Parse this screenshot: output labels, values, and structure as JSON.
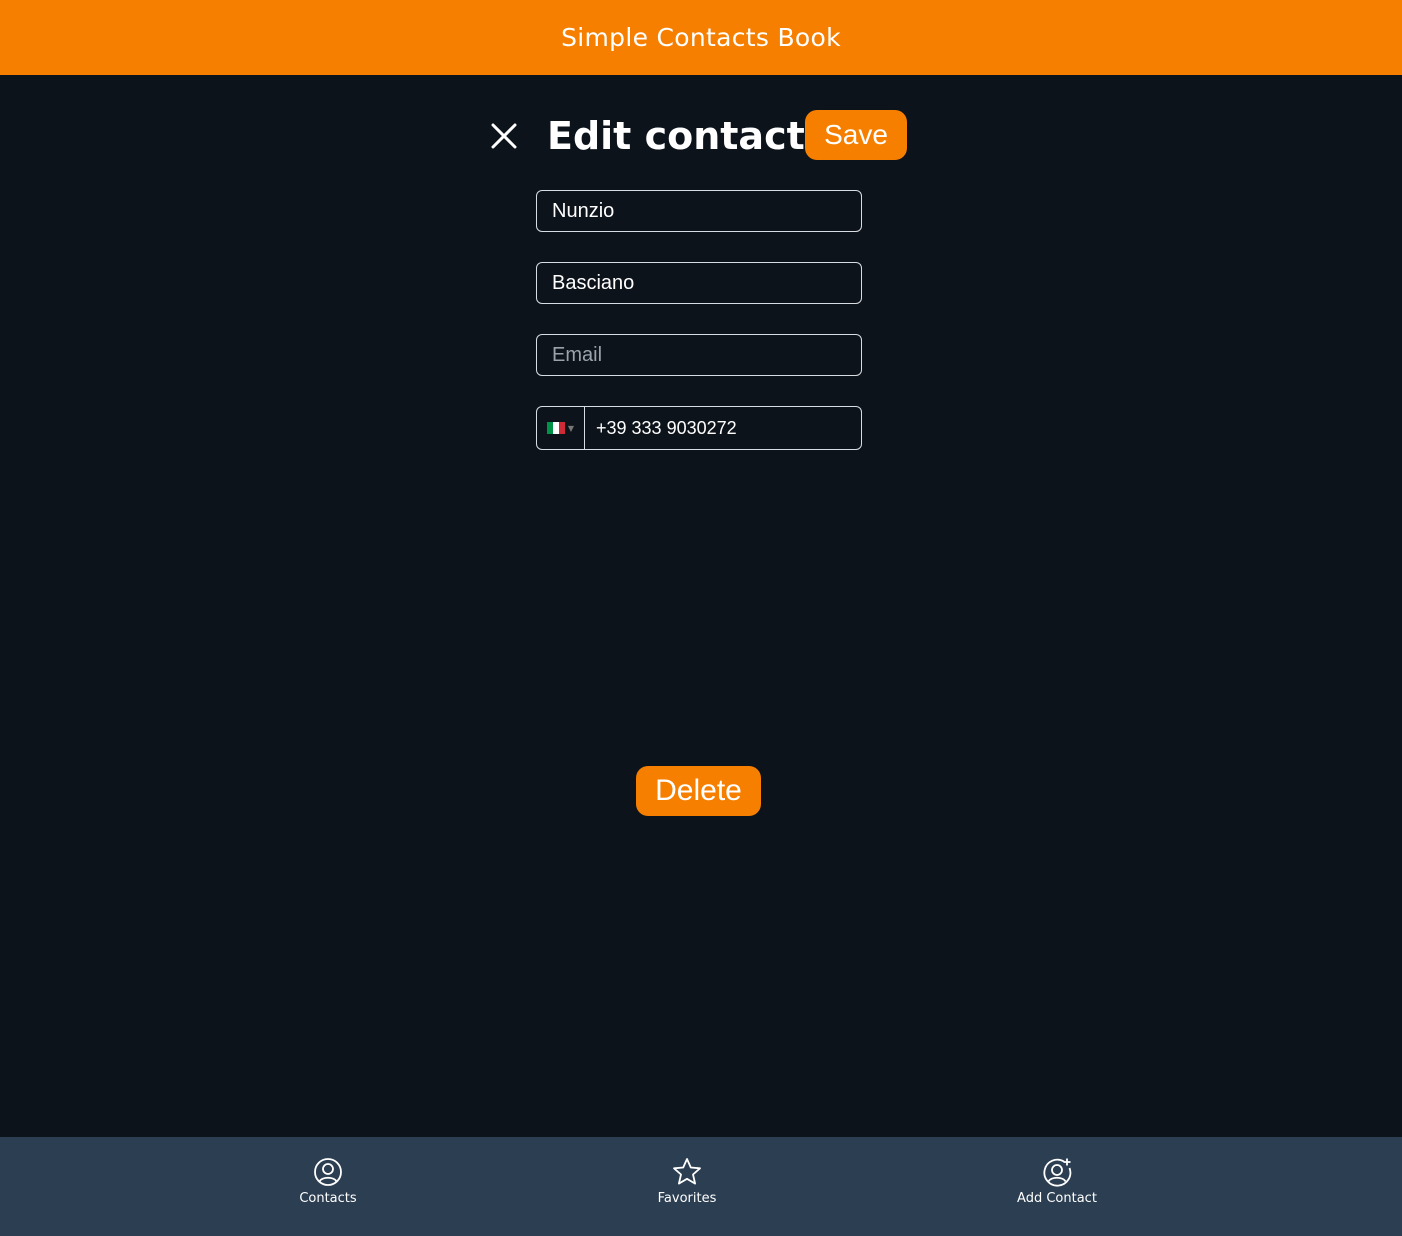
{
  "app": {
    "title": "Simple Contacts Book"
  },
  "edit": {
    "title": "Edit contact",
    "save_label": "Save",
    "close_icon": "close-icon",
    "delete_label": "Delete"
  },
  "form": {
    "first_name": {
      "value": "Nunzio",
      "placeholder": ""
    },
    "last_name": {
      "value": "Basciano",
      "placeholder": ""
    },
    "email": {
      "value": "",
      "placeholder": "Email"
    },
    "phone": {
      "country_flag": "italy-flag-icon",
      "value": "+39 333 9030272"
    }
  },
  "nav": {
    "items": [
      {
        "label": "Contacts",
        "icon": "user-circle-icon"
      },
      {
        "label": "Favorites",
        "icon": "star-icon"
      },
      {
        "label": "Add Contact",
        "icon": "user-add-icon"
      }
    ]
  },
  "colors": {
    "accent": "#f77f00",
    "background": "#0d131a",
    "nav_background": "#2c3e52",
    "text": "#ffffff"
  }
}
